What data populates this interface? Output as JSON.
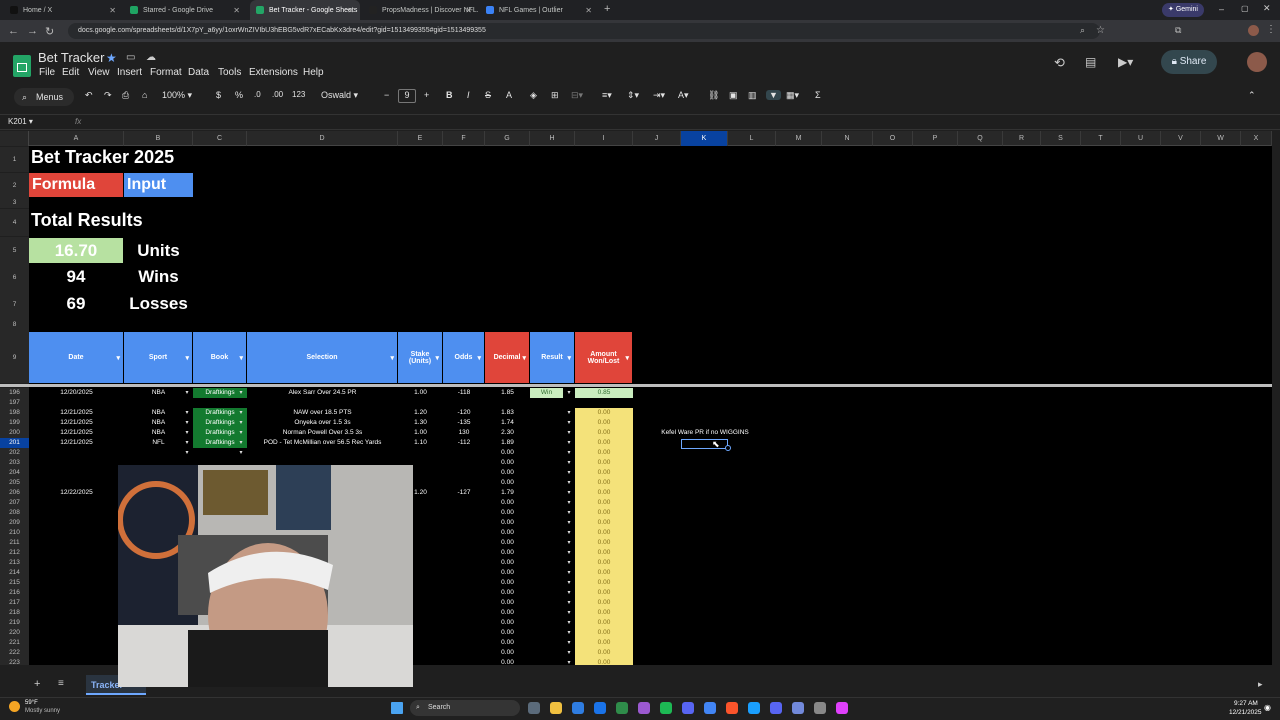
{
  "browser": {
    "tabs": [
      {
        "label": "Home / X",
        "color": "#111111",
        "active": false
      },
      {
        "label": "Starred - Google Drive",
        "color": "#1fa463",
        "active": false
      },
      {
        "label": "Bet Tracker - Google Sheets",
        "color": "#23a566",
        "active": true
      },
      {
        "label": "PropsMadness | Discover NFL...",
        "color": "#222222",
        "active": false
      },
      {
        "label": "NFL Games | Outlier",
        "color": "#3b82f6",
        "active": false
      }
    ],
    "gemini_label": "Gemini",
    "url": "docs.google.com/spreadsheets/d/1X7pY_a6yy/1oxrWnZIVIbU3hEBG5vdR7xECabKx3dre4/edit?gid=1513499355#gid=1513499355"
  },
  "app": {
    "title": "Bet Tracker",
    "menus": [
      "File",
      "Edit",
      "View",
      "Insert",
      "Format",
      "Data",
      "Tools",
      "Extensions",
      "Help"
    ],
    "share_label": "Share"
  },
  "toolbar": {
    "menus_label": "Menus",
    "zoom": "100%",
    "currency": "$",
    "percent": "%",
    "dec_dec": ".0",
    "dec_inc": ".00",
    "num_format": "123",
    "font": "Oswald",
    "font_size": "9"
  },
  "formula": {
    "name_box": "K201",
    "fx": "fx"
  },
  "columns": [
    "A",
    "B",
    "C",
    "D",
    "E",
    "F",
    "G",
    "H",
    "I",
    "J",
    "K",
    "L",
    "M",
    "N",
    "O",
    "P",
    "Q",
    "R",
    "S",
    "T",
    "U",
    "V",
    "W",
    "X"
  ],
  "top_rows": [
    "1",
    "2",
    "3",
    "4",
    "5",
    "6",
    "7",
    "8",
    "9"
  ],
  "summary": {
    "title": "Bet Tracker 2025",
    "formula_label": "Formula",
    "input_label": "Input",
    "total_results": "Total Results",
    "units_value": "16.70",
    "units_label": "Units",
    "wins_value": "94",
    "wins_label": "Wins",
    "losses_value": "69",
    "losses_label": "Losses"
  },
  "headers": [
    "Date",
    "Sport",
    "Book",
    "Selection",
    "Stake (Units)",
    "Odds",
    "Decimal",
    "Result",
    "Amount Won/Lost"
  ],
  "rows": [
    {
      "n": "196",
      "date": "12/20/2025",
      "sport": "NBA",
      "book": "Draftkings",
      "sel": "Alex Sarr Over 24.5 PR",
      "stake": "1.00",
      "odds": "-118",
      "dec": "1.85",
      "result": "Win",
      "amt": "0.85"
    },
    {
      "n": "197",
      "date": "",
      "sport": "",
      "book": "",
      "sel": "",
      "stake": "",
      "odds": "",
      "dec": "",
      "result": "",
      "amt": ""
    },
    {
      "n": "198",
      "date": "12/21/2025",
      "sport": "NBA",
      "book": "Draftkings",
      "sel": "NAW over 18.5 PTS",
      "stake": "1.20",
      "odds": "-120",
      "dec": "1.83",
      "result": "",
      "amt": "0.00"
    },
    {
      "n": "199",
      "date": "12/21/2025",
      "sport": "NBA",
      "book": "Draftkings",
      "sel": "Onyeka over 1.5 3s",
      "stake": "1.30",
      "odds": "-135",
      "dec": "1.74",
      "result": "",
      "amt": "0.00"
    },
    {
      "n": "200",
      "date": "12/21/2025",
      "sport": "NBA",
      "book": "Draftkings",
      "sel": "Norman Powell Over 3.5 3s",
      "stake": "1.00",
      "odds": "130",
      "dec": "2.30",
      "result": "",
      "amt": "0.00"
    },
    {
      "n": "201",
      "date": "12/21/2025",
      "sport": "NFL",
      "book": "Draftkings",
      "sel": "POD - Tet McMillian over 56.5 Rec Yards",
      "stake": "1.10",
      "odds": "-112",
      "dec": "1.89",
      "result": "",
      "amt": "0.00"
    },
    {
      "n": "202",
      "date": "",
      "sport": "",
      "book": "",
      "sel": "",
      "stake": "",
      "odds": "",
      "dec": "0.00",
      "result": "",
      "amt": "0.00"
    },
    {
      "n": "203",
      "date": "",
      "sport": "",
      "book": "",
      "sel": "",
      "stake": "",
      "odds": "",
      "dec": "0.00",
      "result": "",
      "amt": "0.00"
    },
    {
      "n": "204",
      "date": "",
      "sport": "",
      "book": "",
      "sel": "",
      "stake": "",
      "odds": "",
      "dec": "0.00",
      "result": "",
      "amt": "0.00"
    },
    {
      "n": "205",
      "date": "",
      "sport": "",
      "book": "",
      "sel": "",
      "stake": "",
      "odds": "",
      "dec": "0.00",
      "result": "",
      "amt": "0.00"
    },
    {
      "n": "206",
      "date": "12/22/2025",
      "sport": "",
      "book": "",
      "sel": "",
      "stake": "1.20",
      "odds": "-127",
      "dec": "1.79",
      "result": "",
      "amt": "0.00"
    },
    {
      "n": "207",
      "date": "",
      "sport": "",
      "book": "",
      "sel": "",
      "stake": "",
      "odds": "",
      "dec": "0.00",
      "result": "",
      "amt": "0.00"
    },
    {
      "n": "208",
      "date": "",
      "sport": "",
      "book": "",
      "sel": "",
      "stake": "",
      "odds": "",
      "dec": "0.00",
      "result": "",
      "amt": "0.00"
    },
    {
      "n": "209",
      "date": "",
      "sport": "",
      "book": "",
      "sel": "",
      "stake": "",
      "odds": "",
      "dec": "0.00",
      "result": "",
      "amt": "0.00"
    },
    {
      "n": "210",
      "date": "",
      "sport": "",
      "book": "",
      "sel": "",
      "stake": "",
      "odds": "",
      "dec": "0.00",
      "result": "",
      "amt": "0.00"
    },
    {
      "n": "211",
      "date": "",
      "sport": "",
      "book": "",
      "sel": "",
      "stake": "",
      "odds": "",
      "dec": "0.00",
      "result": "",
      "amt": "0.00"
    },
    {
      "n": "212",
      "date": "",
      "sport": "",
      "book": "",
      "sel": "",
      "stake": "",
      "odds": "",
      "dec": "0.00",
      "result": "",
      "amt": "0.00"
    },
    {
      "n": "213",
      "date": "",
      "sport": "",
      "book": "",
      "sel": "",
      "stake": "",
      "odds": "",
      "dec": "0.00",
      "result": "",
      "amt": "0.00"
    },
    {
      "n": "214",
      "date": "",
      "sport": "",
      "book": "",
      "sel": "",
      "stake": "",
      "odds": "",
      "dec": "0.00",
      "result": "",
      "amt": "0.00"
    },
    {
      "n": "215",
      "date": "",
      "sport": "",
      "book": "",
      "sel": "",
      "stake": "",
      "odds": "",
      "dec": "0.00",
      "result": "",
      "amt": "0.00"
    },
    {
      "n": "216",
      "date": "",
      "sport": "",
      "book": "",
      "sel": "",
      "stake": "",
      "odds": "",
      "dec": "0.00",
      "result": "",
      "amt": "0.00"
    },
    {
      "n": "217",
      "date": "",
      "sport": "",
      "book": "",
      "sel": "",
      "stake": "",
      "odds": "",
      "dec": "0.00",
      "result": "",
      "amt": "0.00"
    },
    {
      "n": "218",
      "date": "",
      "sport": "",
      "book": "",
      "sel": "",
      "stake": "",
      "odds": "",
      "dec": "0.00",
      "result": "",
      "amt": "0.00"
    },
    {
      "n": "219",
      "date": "",
      "sport": "",
      "book": "",
      "sel": "",
      "stake": "",
      "odds": "",
      "dec": "0.00",
      "result": "",
      "amt": "0.00"
    },
    {
      "n": "220",
      "date": "",
      "sport": "",
      "book": "",
      "sel": "",
      "stake": "",
      "odds": "",
      "dec": "0.00",
      "result": "",
      "amt": "0.00"
    },
    {
      "n": "221",
      "date": "",
      "sport": "",
      "book": "",
      "sel": "",
      "stake": "",
      "odds": "",
      "dec": "0.00",
      "result": "",
      "amt": "0.00"
    },
    {
      "n": "222",
      "date": "",
      "sport": "",
      "book": "",
      "sel": "",
      "stake": "",
      "odds": "",
      "dec": "0.00",
      "result": "",
      "amt": "0.00"
    },
    {
      "n": "223",
      "date": "",
      "sport": "",
      "book": "",
      "sel": "",
      "stake": "",
      "odds": "",
      "dec": "0.00",
      "result": "",
      "amt": "0.00"
    }
  ],
  "note": "Kefel Ware PR if no WIGGINS",
  "sheet_tab": "Tracker",
  "taskbar": {
    "weather_temp": "59°F",
    "weather_desc": "Mostly sunny",
    "search": "Search",
    "time": "9:27 AM",
    "date": "12/21/2025"
  }
}
